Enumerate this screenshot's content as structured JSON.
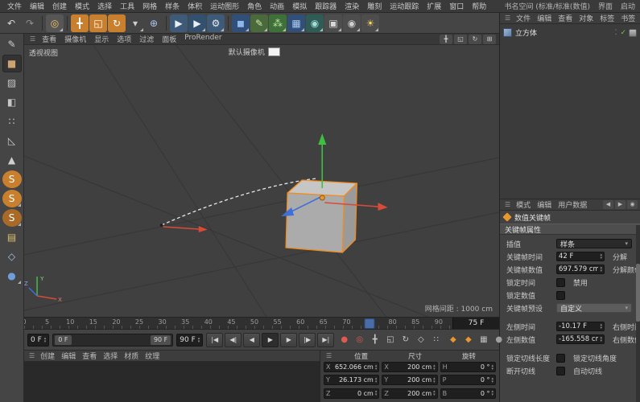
{
  "icons": {
    "hamburger": "☰"
  },
  "colors": {
    "accent": "#e8962e",
    "selection": "#f08c21",
    "axis_x": "#d94b38",
    "axis_y": "#47c14b",
    "axis_z": "#3f6fd8",
    "playhead": "#4a6da8"
  },
  "menubar": {
    "items": [
      "文件",
      "编辑",
      "创建",
      "模式",
      "选择",
      "工具",
      "网格",
      "样条",
      "体积",
      "运动图形",
      "角色",
      "动画",
      "模拟",
      "跟踪器",
      "渲染",
      "雕刻",
      "运动跟踪",
      "扩展",
      "窗口",
      "帮助"
    ],
    "workspace_label": "书名空间 (标准/标准(数值)",
    "interface_label": "界面",
    "layout_label": "启动"
  },
  "toolbar": {
    "icons": [
      {
        "name": "undo-icon",
        "glyph": "↶",
        "fg": "#d8d8d8"
      },
      {
        "name": "redo-icon",
        "glyph": "↷",
        "fg": "#8f8f8f"
      },
      {
        "name": "sep"
      },
      {
        "name": "live-selection-icon",
        "glyph": "◎",
        "fg": "#f3c46a",
        "bg": "#565656",
        "dd": true
      },
      {
        "name": "sep"
      },
      {
        "name": "move-tool-icon",
        "glyph": "╋",
        "fg": "#ffffff",
        "bg": "#c9802e"
      },
      {
        "name": "scale-tool-icon",
        "glyph": "◱",
        "fg": "#ffffff",
        "bg": "#c9802e"
      },
      {
        "name": "rotate-tool-icon",
        "glyph": "↻",
        "fg": "#ffffff",
        "bg": "#c9802e"
      },
      {
        "name": "last-tools-icon",
        "glyph": "▾",
        "fg": "#cfcfcf",
        "dd": true
      },
      {
        "name": "coordinate-system-icon",
        "glyph": "⊕",
        "fg": "#a9c7ef"
      },
      {
        "name": "sep"
      },
      {
        "name": "render-view-icon",
        "glyph": "▶",
        "fg": "#e8eef5",
        "bg": "#3d5a78"
      },
      {
        "name": "render-picture-viewer-icon",
        "glyph": "▶",
        "fg": "#e8eef5",
        "bg": "#33506e",
        "dd": true
      },
      {
        "name": "render-settings-icon",
        "glyph": "⚙",
        "fg": "#e8eef5",
        "bg": "#3d5a78",
        "dd": true
      },
      {
        "name": "sep"
      },
      {
        "name": "primitive-cube-icon",
        "glyph": "◼",
        "fg": "#8fb7ea",
        "bg": "#30507a",
        "dd": true
      },
      {
        "name": "spline-pen-icon",
        "glyph": "✎",
        "fg": "#cde8b0",
        "bg": "#4a6a3c",
        "dd": true
      },
      {
        "name": "mograph-icon",
        "glyph": "⁂",
        "fg": "#bde3a0",
        "bg": "#40703a",
        "dd": true
      },
      {
        "name": "volume-icon",
        "glyph": "▦",
        "fg": "#a9c7ef",
        "bg": "#30507a",
        "dd": true
      },
      {
        "name": "simulate-icon",
        "glyph": "◉",
        "fg": "#a0ded6",
        "bg": "#2f5c56",
        "dd": true
      },
      {
        "name": "tracker-icon",
        "glyph": "▣",
        "fg": "#d8d8d8",
        "bg": "#4d4d4d",
        "dd": true
      },
      {
        "name": "camera-icon",
        "glyph": "◉",
        "fg": "#cfcfcf",
        "bg": "#4d4d4d",
        "dd": true
      },
      {
        "name": "light-icon",
        "glyph": "☀",
        "fg": "#ffd45e",
        "bg": "#4d4d4d",
        "dd": true
      }
    ]
  },
  "left_toolbar": {
    "icons": [
      {
        "name": "make-editable-icon",
        "glyph": "✎",
        "fg": "#cfcfcf"
      },
      {
        "name": "model-mode-icon",
        "glyph": "■",
        "fg": "#cfa271",
        "active": true
      },
      {
        "name": "texture-mode-icon",
        "glyph": "▨",
        "fg": "#c6c6c6"
      },
      {
        "name": "workplane-mode-icon",
        "glyph": "◧",
        "fg": "#c6c6c6"
      },
      {
        "name": "points-mode-icon",
        "glyph": "∷",
        "fg": "#cfcfcf"
      },
      {
        "name": "edges-mode-icon",
        "glyph": "◺",
        "fg": "#cfcfcf"
      },
      {
        "name": "polygons-mode-icon",
        "glyph": "▲",
        "fg": "#cfcfcf"
      },
      {
        "name": "enable-snap-icon",
        "glyph": "S",
        "fg": "#ffffff",
        "bg": "#c9802e",
        "round": true
      },
      {
        "name": "snap-modes-icon",
        "glyph": "S",
        "fg": "#ffffff",
        "bg": "#c9802e",
        "round": true,
        "dd": true
      },
      {
        "name": "quantize-icon",
        "glyph": "S",
        "fg": "#ffffff",
        "bg": "#a86a26",
        "round": true,
        "dd": true
      },
      {
        "name": "paint-tool-icon",
        "glyph": "▤",
        "fg": "#d9c06a"
      },
      {
        "name": "axis-modify-icon",
        "glyph": "◇",
        "fg": "#a9c7ef"
      },
      {
        "name": "viewport-solo-icon",
        "glyph": "●",
        "fg": "#6f9fd8",
        "dd": true
      }
    ]
  },
  "viewport": {
    "menus": [
      "查看",
      "摄像机",
      "显示",
      "选项",
      "过滤",
      "面板",
      "ProRender"
    ],
    "view_label": "透视视图",
    "camera_label": "默认摄像机",
    "grid_info": "网格间距 : 1000 cm",
    "axis_labels": {
      "x": "X",
      "y": "Y",
      "z": "Z"
    },
    "nav_icons": [
      {
        "name": "pan-view-icon",
        "glyph": "╋",
        "fg": "#d0d0d0"
      },
      {
        "name": "zoom-view-icon",
        "glyph": "◱",
        "fg": "#d0d0d0"
      },
      {
        "name": "rotate-view-icon",
        "glyph": "↻",
        "fg": "#d0d0d0"
      },
      {
        "name": "toggle-views-icon",
        "glyph": "⊞",
        "fg": "#d0d0d0"
      }
    ]
  },
  "timeline": {
    "ticks": [
      0,
      5,
      10,
      15,
      20,
      25,
      30,
      35,
      40,
      45,
      50,
      55,
      60,
      65,
      70,
      75,
      80,
      85,
      90
    ],
    "max_display": 93,
    "current_frame": 75,
    "current_frame_label": "75 F"
  },
  "transport": {
    "start_frame": "0 F",
    "range_start": "0 F",
    "range_end": "90 F",
    "end_frame": "90 F",
    "buttons": [
      {
        "name": "go-to-start-button",
        "glyph": "|◀"
      },
      {
        "name": "previous-key-button",
        "glyph": "◀|"
      },
      {
        "name": "previous-frame-button",
        "glyph": "◀"
      },
      {
        "name": "play-button",
        "glyph": "▶",
        "active": true
      },
      {
        "name": "next-frame-button",
        "glyph": "▶"
      },
      {
        "name": "next-key-button",
        "glyph": "|▶"
      },
      {
        "name": "go-to-end-button",
        "glyph": "▶|"
      }
    ],
    "record_icons": [
      {
        "name": "record-keyframe-button",
        "glyph": "●",
        "fg": "#e05a52"
      },
      {
        "name": "autokey-button",
        "glyph": "◎",
        "fg": "#e05a52"
      },
      {
        "name": "record-position-toggle",
        "glyph": "╋",
        "fg": "#c9c9c9"
      },
      {
        "name": "record-scale-toggle",
        "glyph": "◱",
        "fg": "#c9c9c9"
      },
      {
        "name": "record-rotation-toggle",
        "glyph": "↻",
        "fg": "#c9c9c9"
      },
      {
        "name": "record-parameter-toggle",
        "glyph": "◇",
        "fg": "#c9c9c9"
      },
      {
        "name": "record-pla-toggle",
        "glyph": "∷",
        "fg": "#c9c9c9"
      }
    ],
    "right_icons": [
      {
        "name": "keyframe-presets-icon",
        "glyph": "◆",
        "fg": "#e8962e"
      },
      {
        "name": "keyframe-selection-icon",
        "glyph": "◆",
        "fg": "#e8962e"
      },
      {
        "name": "snapshot-icon",
        "glyph": "▦",
        "fg": "#bcbcbc"
      },
      {
        "name": "solo-toggle-icon",
        "glyph": "●",
        "fg": "#9f9f9f"
      }
    ]
  },
  "material_manager": {
    "menus": [
      "创建",
      "编辑",
      "查看",
      "选择",
      "材质",
      "纹理"
    ]
  },
  "coordinates": {
    "groups": [
      {
        "title": "位置",
        "rows": [
          [
            "X",
            "652.066 cm"
          ],
          [
            "Y",
            "26.173 cm"
          ],
          [
            "Z",
            "0 cm"
          ]
        ]
      },
      {
        "title": "尺寸",
        "rows": [
          [
            "X",
            "200 cm"
          ],
          [
            "Y",
            "200 cm"
          ],
          [
            "Z",
            "200 cm"
          ]
        ]
      },
      {
        "title": "旋转",
        "rows": [
          [
            "H",
            "0 °"
          ],
          [
            "P",
            "0 °"
          ],
          [
            "B",
            "0 °"
          ]
        ]
      }
    ]
  },
  "object_manager": {
    "menus": [
      "文件",
      "编辑",
      "查看",
      "对象",
      "标签",
      "书签"
    ],
    "object_name": "立方体"
  },
  "attributes": {
    "menus": [
      "模式",
      "编辑",
      "用户数据"
    ],
    "nav_icons": [
      {
        "name": "history-back-icon",
        "glyph": "◀",
        "fg": "#bbbbbb"
      },
      {
        "name": "history-forward-icon",
        "glyph": "▶",
        "fg": "#bbbbbb"
      },
      {
        "name": "configure-icon",
        "glyph": "◉",
        "fg": "#bbbbbb"
      }
    ],
    "title": "数值关键帧",
    "section": "关键帧属性",
    "rows": {
      "interpolation": {
        "label": "插值",
        "value": "样条"
      },
      "key_time": {
        "label": "关键帧时间",
        "value": "42 F",
        "right_label": "分解"
      },
      "key_value": {
        "label": "关键帧数值",
        "value": "697.579 cm",
        "right_label": "分解颜色"
      },
      "lock_time": {
        "label": "锁定时间",
        "right_label": "禁用"
      },
      "lock_value": {
        "label": "锁定数值"
      },
      "preset": {
        "label": "关键帧预设",
        "value": "自定义"
      },
      "left_time": {
        "label": "左侧时间",
        "value": "-10.17 F",
        "right_label": "右侧时间"
      },
      "left_value": {
        "label": "左侧数值",
        "value": "-165.558 cm",
        "right_label": "右侧数值"
      },
      "lock_tangent_length": {
        "label": "锁定切线长度",
        "right_label": "锁定切线角度"
      },
      "break_tangent": {
        "label": "断开切线",
        "right_label": "自动切线"
      }
    }
  }
}
